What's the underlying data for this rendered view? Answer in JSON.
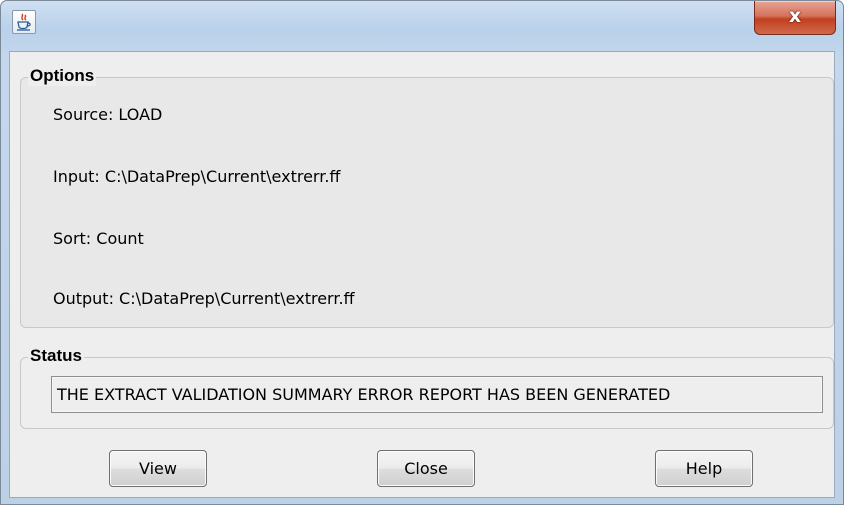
{
  "window": {
    "icon": "java-cup-icon",
    "close_symbol": "x"
  },
  "options": {
    "title": "Options",
    "source": "Source: LOAD",
    "input": "Input: C:\\DataPrep\\Current\\extrerr.ff",
    "sort": "Sort: Count",
    "output": "Output: C:\\DataPrep\\Current\\extrerr.ff"
  },
  "status": {
    "title": "Status",
    "message": "THE EXTRACT VALIDATION SUMMARY ERROR REPORT HAS BEEN GENERATED"
  },
  "buttons": {
    "view": "View",
    "close": "Close",
    "help": "Help"
  }
}
